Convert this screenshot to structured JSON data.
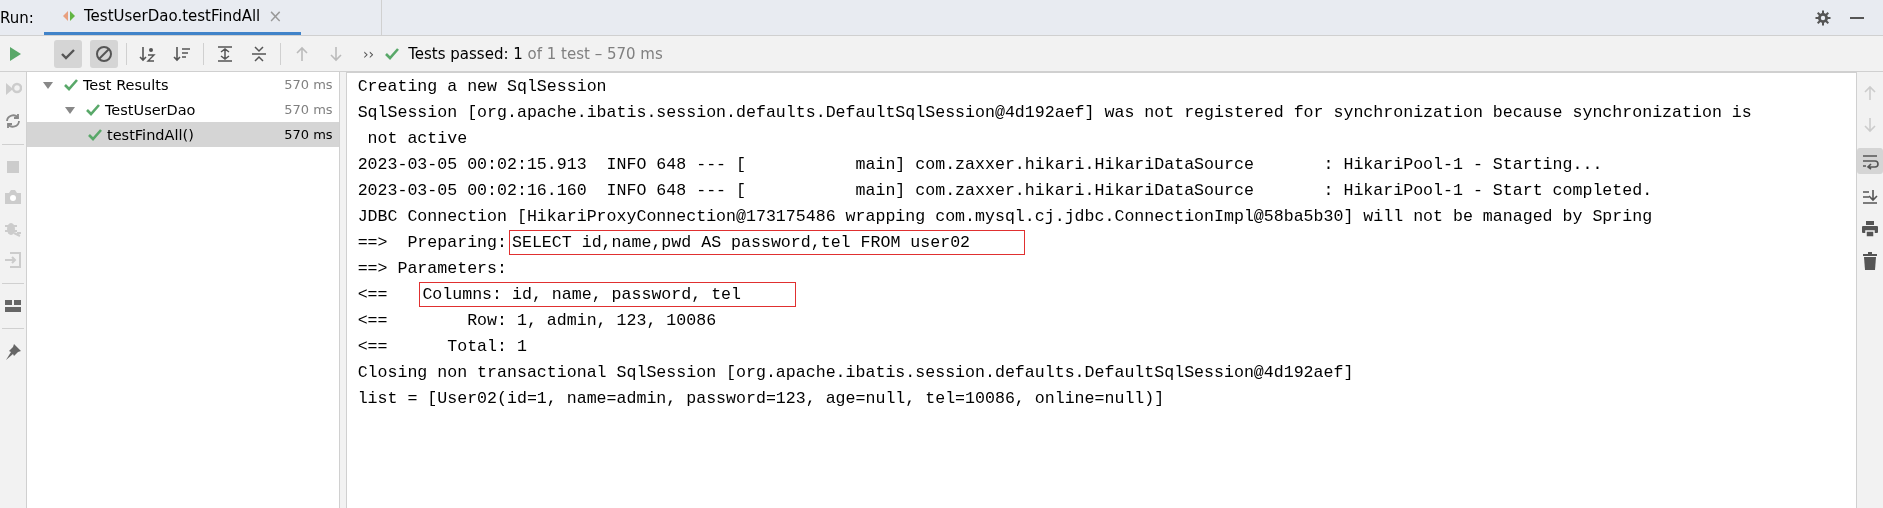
{
  "run_label": "Run:",
  "tab": {
    "title": "TestUserDao.testFindAll",
    "selected": true,
    "close": "×"
  },
  "toolbar": {
    "show_passed": {
      "selected": true
    },
    "show_ignored": {
      "selected": true
    },
    "more": "››",
    "summary_main": "Tests passed: 1",
    "summary_detail": "of 1 test – 570 ms"
  },
  "tree": [
    {
      "name": "Test Results",
      "time": "570 ms",
      "selected": false,
      "expanded": true,
      "children": [
        {
          "name": "TestUserDao",
          "time": "570 ms",
          "selected": false,
          "expanded": true,
          "children": [
            {
              "name": "testFindAll()",
              "time": "570 ms",
              "selected": true
            }
          ]
        }
      ]
    }
  ],
  "console": [
    {
      "segments": [
        {
          "text": "Creating a new SqlSession",
          "boxed": false
        }
      ]
    },
    {
      "segments": [
        {
          "text": "SqlSession [org.apache.ibatis.session.defaults.DefaultSqlSession@4d192aef] was not registered for synchronization because synchronization is",
          "boxed": false
        }
      ]
    },
    {
      "segments": [
        {
          "text": " not active",
          "boxed": false
        }
      ]
    },
    {
      "segments": [
        {
          "text": "2023-03-05 00:02:15.913  INFO 648 --- [           main] com.zaxxer.hikari.HikariDataSource       : HikariPool-1 - Starting...",
          "boxed": false
        }
      ]
    },
    {
      "segments": [
        {
          "text": "2023-03-05 00:02:16.160  INFO 648 --- [           main] com.zaxxer.hikari.HikariDataSource       : HikariPool-1 - Start completed.",
          "boxed": false
        }
      ]
    },
    {
      "segments": [
        {
          "text": "JDBC Connection [HikariProxyConnection@173175486 wrapping com.mysql.cj.jdbc.ConnectionImpl@58ba5b30] will not be managed by Spring",
          "boxed": false
        }
      ]
    },
    {
      "segments": [
        {
          "text": "==>  Preparing:",
          "boxed": false
        },
        {
          "text": "SELECT id,name,pwd AS password,tel FROM user02",
          "boxed": true
        }
      ]
    },
    {
      "segments": [
        {
          "text": "==> Parameters:",
          "boxed": false
        }
      ]
    },
    {
      "segments": [
        {
          "text": "<==   ",
          "boxed": false
        },
        {
          "text": "Columns: id, name, password, tel",
          "boxed": true
        }
      ]
    },
    {
      "segments": [
        {
          "text": "<==        Row: 1, admin, 123, 10086",
          "boxed": false
        }
      ]
    },
    {
      "segments": [
        {
          "text": "<==      Total: 1",
          "boxed": false
        }
      ]
    },
    {
      "segments": [
        {
          "text": "Closing non transactional SqlSession [org.apache.ibatis.session.defaults.DefaultSqlSession@4d192aef]",
          "boxed": false
        }
      ]
    },
    {
      "segments": [
        {
          "text": "list = [User02(id=1, name=admin, password=123, age=null, tel=10086, online=null)]",
          "boxed": false
        }
      ]
    }
  ],
  "side_actions": {
    "soft_wrap": {
      "selected": true
    }
  }
}
